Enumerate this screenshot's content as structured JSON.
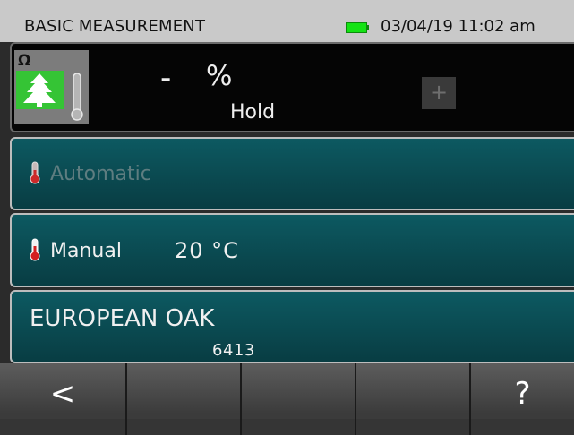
{
  "status": {
    "title": "BASIC MEASUREMENT",
    "datetime": "03/04/19 11:02 am",
    "battery_color": "#14e314"
  },
  "measurement": {
    "mode_symbol": "Ω",
    "mode_icon": "tree-icon",
    "value": "-",
    "unit": "%",
    "status": "Hold",
    "plus": "+"
  },
  "temperature": {
    "automatic_label": "Automatic",
    "manual_label": "Manual",
    "manual_value": "20 °C"
  },
  "species": {
    "name": "EUROPEAN OAK",
    "code": "6413"
  },
  "toolbar": {
    "back": "<",
    "help": "?"
  },
  "colors": {
    "panel_teal": "#0d5a62",
    "status_bg": "#c9c9c9",
    "thermo_red": "#d42020"
  }
}
